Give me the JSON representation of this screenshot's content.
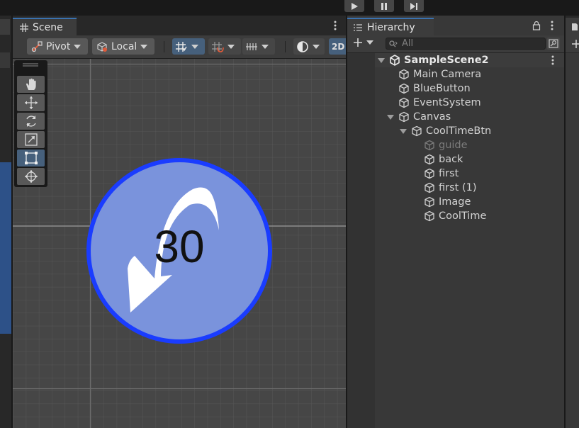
{
  "playbar": {
    "buttons": [
      {
        "name": "play",
        "icon": "play-icon"
      },
      {
        "name": "pause",
        "icon": "pause-icon"
      },
      {
        "name": "step",
        "icon": "step-icon"
      }
    ]
  },
  "scene": {
    "tab_label": "Scene",
    "toolbar": {
      "pivot_label": "Pivot",
      "local_label": "Local",
      "mode_2d_label": "2D"
    },
    "tools": [
      {
        "name": "hand-tool",
        "icon": "hand-icon",
        "selected": false
      },
      {
        "name": "move-tool",
        "icon": "move-icon",
        "selected": false
      },
      {
        "name": "rotate-tool",
        "icon": "rotate-icon",
        "selected": false
      },
      {
        "name": "scale-tool",
        "icon": "scale-icon",
        "selected": false
      },
      {
        "name": "rect-tool",
        "icon": "rect-transform-icon",
        "selected": true
      },
      {
        "name": "transform-tool",
        "icon": "transform-icon",
        "selected": false
      }
    ],
    "cooltime_button": {
      "countdown_text": "30",
      "fill_color": "#7a93dc",
      "ring_color": "#1a3cff",
      "arrow_color": "#ffffff"
    }
  },
  "hierarchy": {
    "tab_label": "Hierarchy",
    "search_placeholder": "All",
    "scene_name": "SampleScene2",
    "items": [
      {
        "label": "Main Camera",
        "depth": 1,
        "expanded": null,
        "active": true
      },
      {
        "label": "BlueButton",
        "depth": 1,
        "expanded": null,
        "active": true
      },
      {
        "label": "EventSystem",
        "depth": 1,
        "expanded": null,
        "active": true
      },
      {
        "label": "Canvas",
        "depth": 1,
        "expanded": true,
        "active": true
      },
      {
        "label": "CoolTimeBtn",
        "depth": 2,
        "expanded": true,
        "active": true
      },
      {
        "label": "guide",
        "depth": 3,
        "expanded": null,
        "active": false
      },
      {
        "label": "back",
        "depth": 3,
        "expanded": null,
        "active": true
      },
      {
        "label": "first",
        "depth": 3,
        "expanded": null,
        "active": true
      },
      {
        "label": "first (1)",
        "depth": 3,
        "expanded": null,
        "active": true
      },
      {
        "label": "Image",
        "depth": 3,
        "expanded": null,
        "active": true
      },
      {
        "label": "CoolTime",
        "depth": 3,
        "expanded": null,
        "active": true
      }
    ]
  },
  "colors": {
    "accent_tab": "#3a72b0",
    "selected_tool": "#46607c",
    "panel_bg": "#383838"
  }
}
